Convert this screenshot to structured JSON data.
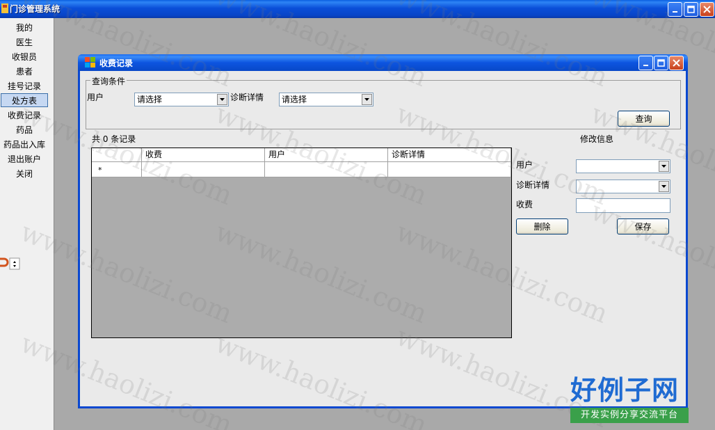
{
  "main_window": {
    "title": "门诊管理系统"
  },
  "sidebar": {
    "items": [
      {
        "label": "我的"
      },
      {
        "label": "医生"
      },
      {
        "label": "收银员"
      },
      {
        "label": "患者"
      },
      {
        "label": "挂号记录"
      },
      {
        "label": "处方表",
        "active": true
      },
      {
        "label": "收费记录"
      },
      {
        "label": "药品"
      },
      {
        "label": "药品出入库"
      },
      {
        "label": "退出账户"
      },
      {
        "label": "关闭"
      }
    ]
  },
  "child_window": {
    "title": "收费记录"
  },
  "query": {
    "group_title": "查询条件",
    "user_label": "用户",
    "user_value": "请选择",
    "diag_label": "诊断详情",
    "diag_value": "请选择",
    "query_button": "查询"
  },
  "records": {
    "count_text": "共 0 条记录",
    "columns": [
      "收费",
      "用户",
      "诊断详情"
    ],
    "new_row_marker": "*"
  },
  "edit": {
    "title": "修改信息",
    "user_label": "用户",
    "diag_label": "诊断详情",
    "fee_label": "收费",
    "user_value": "",
    "diag_value": "",
    "fee_value": "",
    "delete_button": "删除",
    "save_button": "保存"
  },
  "watermark": {
    "text": "www.haolizi.com",
    "brand": "好例子网",
    "brand_sub": "开发实例分享交流平台"
  },
  "colors": {
    "titlebar": "#0a4fd8",
    "mdi_background": "#a9a9a9",
    "sidebar_active": "#c6d8f2",
    "brand_blue": "#1f6bd2",
    "brand_green": "#3aa04a"
  }
}
